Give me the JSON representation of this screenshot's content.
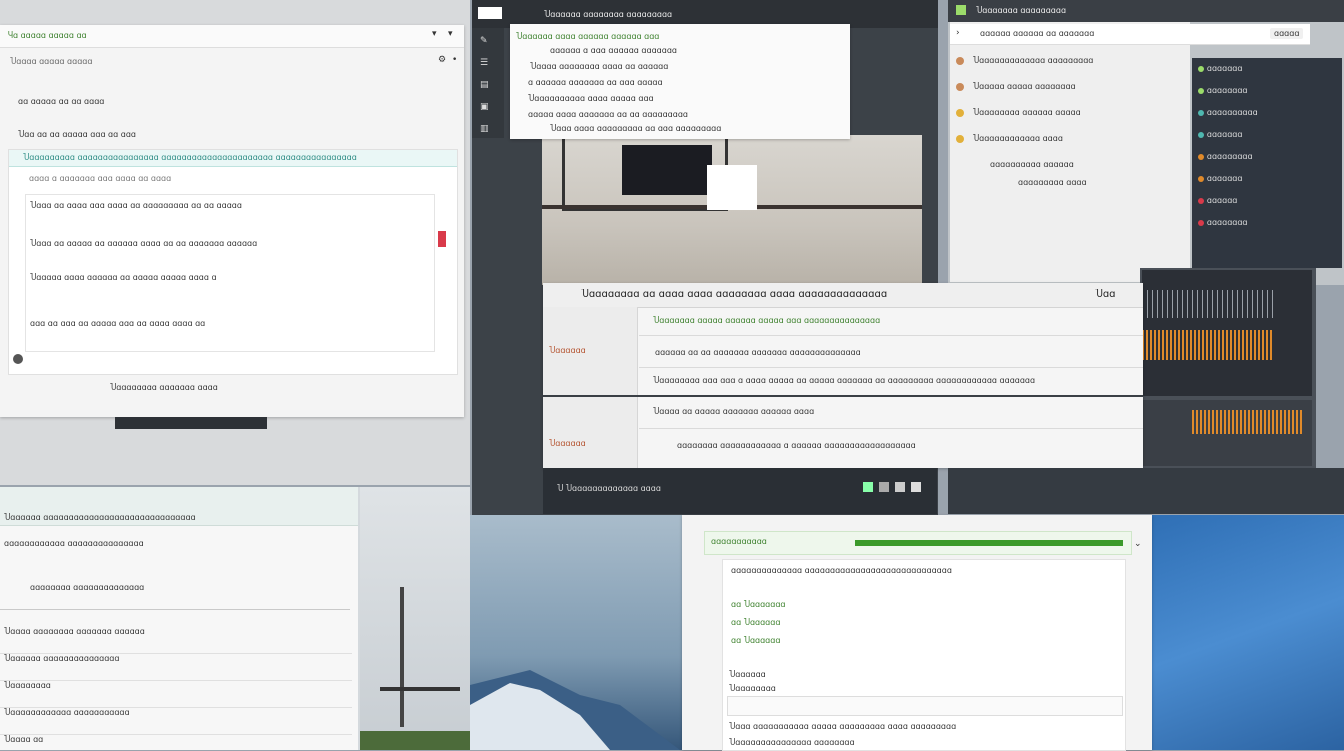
{
  "panels": {
    "top_left": {
      "window_title": "Ⴗɑ ɑɑɑɑɑ ɑɑɑɑɑ ɑɑ",
      "toolbar_label": "Ⴎɑɑɑɑ ɑɑɑɑɑ ɑɑɑɑɑ",
      "line1": "ɑɑ ɑɑɑɑɑ ɑɑ ɑɑ ɑɑɑɑ",
      "line2": "Ⴎɑɑ ɑɑ ɑɑ ɑɑɑɑɑ ɑɑɑ ɑɑ ɑɑɑ",
      "banner": "Ⴎɑɑɑɑɑɑɑɑɑ ɑɑɑɑɑɑɑɑɑɑɑɑɑɑɑɑ ɑɑɑɑɑɑɑɑɑɑɑɑɑɑɑɑɑɑɑɑɑɑ ɑɑɑɑɑɑɑɑɑɑɑɑɑɑɑɑ",
      "sub": "ɑɑɑɑ ɑ ɑɑɑɑɑɑɑ ɑɑɑ ɑɑɑɑ ɑɑ ɑɑɑɑ",
      "body1": "Ⴎɑɑɑ ɑɑ ɑɑɑɑ ɑɑɑ ɑɑɑɑ ɑɑ ɑɑɑɑɑɑɑɑɑ ɑɑ ɑɑ ɑɑɑɑɑ",
      "body2": "Ⴎɑɑɑ ɑɑ ɑɑɑɑɑ ɑɑ ɑɑɑɑɑɑ ɑɑɑɑ ɑɑ ɑɑ ɑɑɑɑɑɑɑ ɑɑɑɑɑɑ",
      "body3": "Ⴎɑɑɑɑɑ ɑɑɑɑ ɑɑɑɑɑɑ ɑɑ ɑɑɑɑɑ ɑɑɑɑɑ ɑɑɑɑ ɑ",
      "body4": "ɑɑɑ ɑɑ ɑɑɑ ɑɑ ɑɑɑɑɑ ɑɑɑ ɑɑ ɑɑɑɑ ɑɑɑɑ ɑɑ",
      "footer": "Ⴎɑɑɑɑɑɑɑɑ ɑɑɑɑɑɑɑ ɑɑɑɑ"
    },
    "top_mid": {
      "window_title": "Ⴎɑɑɑɑɑɑ ɑɑɑɑɑɑɑɑ ɑɑɑɑɑɑɑɑɑ",
      "popup_line1": "Ⴎɑɑɑɑɑɑ ɑɑɑɑ ɑɑɑɑɑɑ ɑɑɑɑɑɑ ɑɑɑ",
      "popup_line2": "ɑɑɑɑɑɑ ɑ ɑɑɑ ɑɑɑɑɑɑ ɑɑɑɑɑɑɑ",
      "popup_line3": "Ⴎɑɑɑɑ ɑɑɑɑɑɑɑɑ ɑɑɑɑ ɑɑ ɑɑɑɑɑɑ",
      "popup_line4": "ɑ ɑɑɑɑɑɑ ɑɑɑɑɑɑɑ ɑɑ ɑɑɑ ɑɑɑɑɑ",
      "popup_line5": "Ⴎɑɑɑɑɑɑɑɑɑɑ ɑɑɑɑ ɑɑɑɑɑ ɑɑɑ",
      "popup_line6": "ɑɑɑɑɑ ɑɑɑɑ ɑɑɑɑɑɑɑ ɑɑ ɑɑ ɑɑɑɑɑɑɑɑɑ",
      "popup_line7": "Ⴎɑɑɑ ɑɑɑɑ ɑɑɑɑɑɑɑɑɑ ɑɑ ɑɑɑ ɑɑɑɑɑɑɑɑɑ",
      "side_icons": [
        "edit-icon",
        "list-icon",
        "chart-icon",
        "image-icon",
        "folder-icon"
      ]
    },
    "top_right": {
      "window_title": "Ⴎɑɑɑɑɑɑɑ ɑɑɑɑɑɑɑɑɑ",
      "search_value": "ɑɑɑɑɑɑ ɑɑɑɑɑɑ ɑɑ ɑɑɑɑɑɑɑ",
      "button_label": "ɑɑɑɑɑ",
      "items": [
        "Ⴎɑɑɑɑɑɑɑɑɑɑɑɑɑ ɑɑɑɑɑɑɑɑɑ",
        "Ⴎɑɑɑɑɑ ɑɑɑɑɑ ɑɑɑɑɑɑɑɑ",
        "Ⴎɑɑɑɑɑɑɑɑ ɑɑɑɑɑɑ ɑɑɑɑɑ",
        "Ⴎɑɑɑɑɑɑɑɑɑɑɑɑ ɑɑɑɑ"
      ],
      "sub_items": [
        "ɑɑɑɑɑɑɑɑɑɑ ɑɑɑɑɑɑ",
        "ɑɑɑɑɑɑɑɑɑ ɑɑɑɑ"
      ],
      "dark_list": [
        "ɑɑɑɑɑɑɑ",
        "ɑɑɑɑɑɑɑɑ",
        "ɑɑɑɑɑɑɑɑɑɑ",
        "ɑɑɑɑɑɑɑ",
        "ɑɑɑɑɑɑɑɑɑ",
        "ɑɑɑɑɑɑɑ",
        "ɑɑɑɑɑɑ",
        "ɑɑɑɑɑɑɑɑ"
      ]
    },
    "center": {
      "header": "Ⴎɑɑɑɑɑɑɑɑ ɑɑ ɑɑɑɑ ɑɑɑɑ ɑɑɑɑɑɑɑɑ ɑɑɑɑ ɑɑɑɑɑɑɑɑɑɑɑɑɑɑ",
      "header_right": "Ⴎɑɑ",
      "rows": [
        {
          "label": "",
          "text": "Ⴎɑɑɑɑɑɑɑ ɑɑɑɑɑ ɑɑɑɑɑɑ ɑɑɑɑɑ ɑɑɑ ɑɑɑɑɑɑɑɑɑɑɑɑɑɑɑ",
          "green": true
        },
        {
          "label": "Ⴎɑɑɑɑɑɑ",
          "text": "ɑɑɑɑɑɑ ɑɑ ɑɑ ɑɑɑɑɑɑɑ ɑɑɑɑɑɑɑ ɑɑɑɑɑɑɑɑɑɑɑɑɑɑ",
          "green": false
        },
        {
          "label": "",
          "text": "Ⴎɑɑɑɑɑɑɑɑ ɑɑɑ ɑɑɑ ɑ ɑɑɑɑ ɑɑɑɑɑ ɑɑ ɑɑɑɑɑ ɑɑɑɑɑɑɑ ɑɑ ɑɑɑɑɑɑɑɑɑ ɑɑɑɑɑɑɑɑɑɑɑɑ ɑɑɑɑɑɑɑ",
          "green": false
        },
        {
          "label": "",
          "text": "Ⴎɑɑɑɑ ɑɑ ɑɑɑɑɑ ɑɑɑɑɑɑɑ ɑɑɑɑɑɑ ɑɑɑɑ",
          "green": false
        },
        {
          "label": "Ⴎɑɑɑɑɑɑ",
          "text": "ɑɑɑɑɑɑɑɑ ɑɑɑɑɑɑɑɑɑɑɑɑ ɑ ɑɑɑɑɑɑ ɑɑɑɑɑɑɑɑɑɑɑɑɑɑɑɑɑɑ",
          "green": false
        }
      ],
      "footer": "Ⴎɑɑɑɑɑɑɑɑɑɑɑɑɑɑɑɑɑɑɑ ɑɑɑ"
    },
    "bottom_left": {
      "header": "Ⴎɑɑɑɑɑɑ ɑɑɑɑɑɑɑɑɑɑɑɑɑɑɑɑɑɑɑɑɑɑɑɑɑɑɑɑɑɑ",
      "sub": "ɑɑɑɑɑɑɑɑɑɑɑɑ ɑɑɑɑɑɑɑɑɑɑɑɑɑɑɑ",
      "line1": "ɑɑɑɑɑɑɑɑ ɑɑɑɑɑɑɑɑɑɑɑɑɑɑ",
      "rows": [
        "Ⴎɑɑɑɑ ɑɑɑɑɑɑɑɑ ɑɑɑɑɑɑɑ ɑɑɑɑɑɑ",
        "Ⴎɑɑɑɑɑɑ ɑɑɑɑɑɑɑɑɑɑɑɑɑɑɑ",
        "Ⴎɑɑɑɑɑɑɑɑ",
        "Ⴎɑɑɑɑɑɑɑɑɑɑɑɑ ɑɑɑɑɑɑɑɑɑɑɑ",
        "Ⴎɑɑɑɑ ɑɑ"
      ]
    },
    "bottom_mid": {
      "header": "ɑɑɑɑɑɑɑɑɑɑɑ",
      "line1": "ɑɑɑɑɑɑɑɑɑɑɑɑɑɑ ɑɑɑɑɑɑɑɑɑɑɑɑɑɑɑɑɑɑɑɑɑɑɑɑɑɑɑɑɑ",
      "options": [
        "ɑɑ Ⴎɑɑɑɑɑɑɑ",
        "ɑɑ Ⴎɑɑɑɑɑɑ",
        "ɑɑ Ⴎɑɑɑɑɑɑ"
      ],
      "label": "Ⴎɑɑɑɑɑɑ",
      "sub_label": "Ⴎɑɑɑɑɑɑɑɑ",
      "input_value": "",
      "bottom_text": "Ⴎɑɑɑ ɑɑɑɑɑɑɑɑɑɑɑ ɑɑɑɑɑ ɑɑɑɑɑɑɑɑɑ ɑɑɑɑ ɑɑɑɑɑɑɑɑɑ",
      "footer_text": "Ⴎɑɑɑɑɑɑɑɑɑɑɑɑɑɑɑ ɑɑɑɑɑɑɑɑ"
    },
    "taskbar": {
      "label": "Ⴎ Ⴎɑɑɑɑɑɑɑɑɑɑɑɑɑ ɑɑɑɑ"
    }
  },
  "colors": {
    "accent_green": "#3b9a2a",
    "accent_teal": "#4fb8b0",
    "dark_bg": "#2f3640",
    "warning_red": "#d93a4a",
    "orange": "#e08a2a"
  }
}
